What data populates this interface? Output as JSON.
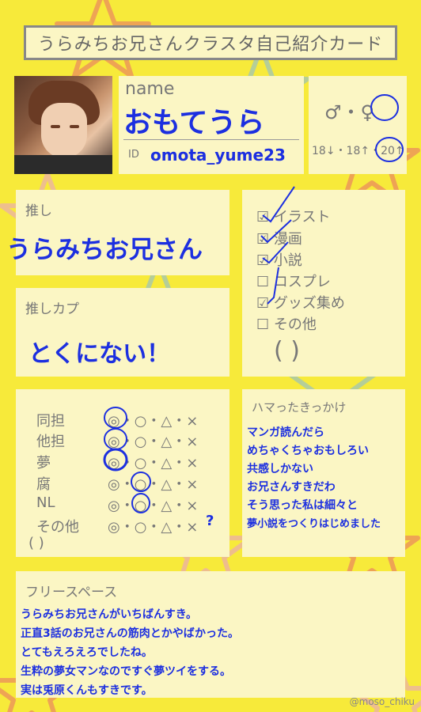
{
  "card": {
    "title": "うらみちお兄さんクラスタ自己紹介カード",
    "name_label": "name",
    "name_value": "おもてうら",
    "id_label": "ID",
    "id_value": "omota_yume23",
    "gender": "♂・♀",
    "age": "18↓・18↑・20↑",
    "oshi_label": "推し",
    "oshi_value": "うらみちお兄さん",
    "oshikapu_label": "推しカプ",
    "oshikapu_value": "とくにない！",
    "activities": [
      {
        "label": "イラスト",
        "checked": true
      },
      {
        "label": "漫画",
        "checked": true
      },
      {
        "label": "小説",
        "checked": true
      },
      {
        "label": "コスプレ",
        "checked": false
      },
      {
        "label": "グッズ集め",
        "checked": true
      },
      {
        "label": "その他",
        "checked": false
      }
    ],
    "paren": "(                    )",
    "stance": [
      {
        "label": "同担",
        "options": "◎・○・△・×"
      },
      {
        "label": "他担",
        "options": "◎・○・△・×"
      },
      {
        "label": "夢",
        "options": "◎・○・△・×"
      },
      {
        "label": "腐",
        "options": "◎・○・△・×"
      },
      {
        "label": "NL",
        "options": "◎・○・△・×"
      },
      {
        "label": "その他",
        "options": "◎・○・△・×"
      }
    ],
    "stance_paren": "(           )",
    "question_mark": "?",
    "trigger_label": "ハマったきっかけ",
    "trigger_lines": [
      "マンガ読んだら",
      "めちゃくちゃおもしろい",
      "共感しかない",
      "お兄さんすきだわ",
      "そう思った私は細々と",
      "夢小説をつくりはじめました"
    ],
    "free_label": "フリースペース",
    "free_lines": [
      "うらみちお兄さんがいちばんすき。",
      "正直3話のお兄さんの筋肉とかやばかった。",
      "とてもえろえろでしたね。",
      "生粋の夢女マンなのですぐ夢ツイをする。",
      "実は兎原くんもすきです。"
    ],
    "credit": "@moso_chiku"
  },
  "colors": {
    "background": "#f7ea3a",
    "panel": "#fbf6c4",
    "ink": "#1c2fe0",
    "label": "#777777"
  }
}
